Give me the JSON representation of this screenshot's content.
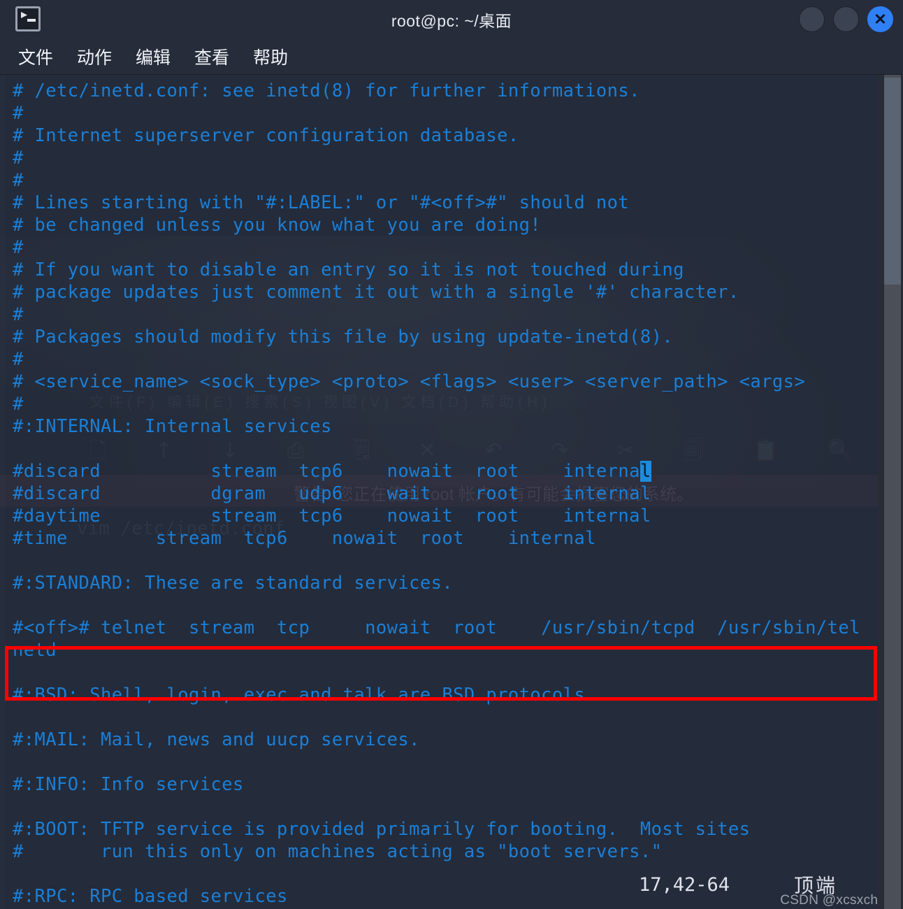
{
  "window": {
    "title": "root@pc: ~/桌面",
    "icon": "terminal-icon",
    "buttons": {
      "minimize": "",
      "maximize": "",
      "close": "✕"
    },
    "accent_close_color": "#2f7ff5"
  },
  "menubar": {
    "items": [
      {
        "label": "文件"
      },
      {
        "label": "动作"
      },
      {
        "label": "编辑"
      },
      {
        "label": "查看"
      },
      {
        "label": "帮助"
      }
    ]
  },
  "terminal": {
    "background_color": "#242b3a",
    "text_color": "#1b7fd6",
    "lines": [
      "# /etc/inetd.conf: see inetd(8) for further informations.",
      "#",
      "# Internet superserver configuration database.",
      "#",
      "#",
      "# Lines starting with \"#:LABEL:\" or \"#<off>#\" should not",
      "# be changed unless you know what you are doing!",
      "#",
      "# If you want to disable an entry so it is not touched during",
      "# package updates just comment it out with a single '#' character.",
      "#",
      "# Packages should modify this file by using update-inetd(8).",
      "#",
      "# <service_name> <sock_type> <proto> <flags> <user> <server_path> <args>",
      "#",
      "#:INTERNAL: Internal services",
      "",
      "#discard          stream  tcp6    nowait  root    internal",
      "#discard          dgram   udp6    wait    root    internal",
      "#daytime          stream  tcp6    nowait  root    internal",
      "#time        stream  tcp6    nowait  root    internal",
      "",
      "#:STANDARD: These are standard services.",
      "",
      "#<off># telnet  stream  tcp     nowait  root    /usr/sbin/tcpd  /usr/sbin/tel",
      "netd",
      "",
      "#:BSD: Shell, login, exec and talk are BSD protocols.",
      "",
      "#:MAIL: Mail, news and uucp services.",
      "",
      "#:INFO: Info services",
      "",
      "#:BOOT: TFTP service is provided primarily for booting.  Most sites",
      "#       run this only on machines acting as \"boot servers.\"",
      "",
      "#:RPC: RPC based services"
    ],
    "cursor": {
      "line_index": 17,
      "char": "l",
      "color": "#1e8bdc"
    }
  },
  "annotation": {
    "type": "rectangle",
    "color": "#ff0000",
    "target_line": "#<off># telnet  stream  tcp     nowait  root    /usr/sbin/tcpd  /usr/sbin/telnetd"
  },
  "statusline": {
    "position": "17,42-64",
    "scroll_state": "顶端"
  },
  "watermarks": {
    "csdn": "CSDN @xcsxchen",
    "ghost_menu": "文件(F)  编辑(E)  搜索(S)  视图(V)  文档(D)  帮助(H)",
    "ghost_toolbar": "🗋 ↑ ↓ ⎙ 🗒 ✕ ↶ ↷ ✂ 🗐 📋 🔍 🔎",
    "ghost_warning": "警告: 您正在使用 root 帐户。有可能会损害您的系统。",
    "ghost_command": "vim /etc/inetd.conf"
  },
  "scrollbar": {
    "thumb_top_pct": 0,
    "thumb_height_pct": 25
  }
}
